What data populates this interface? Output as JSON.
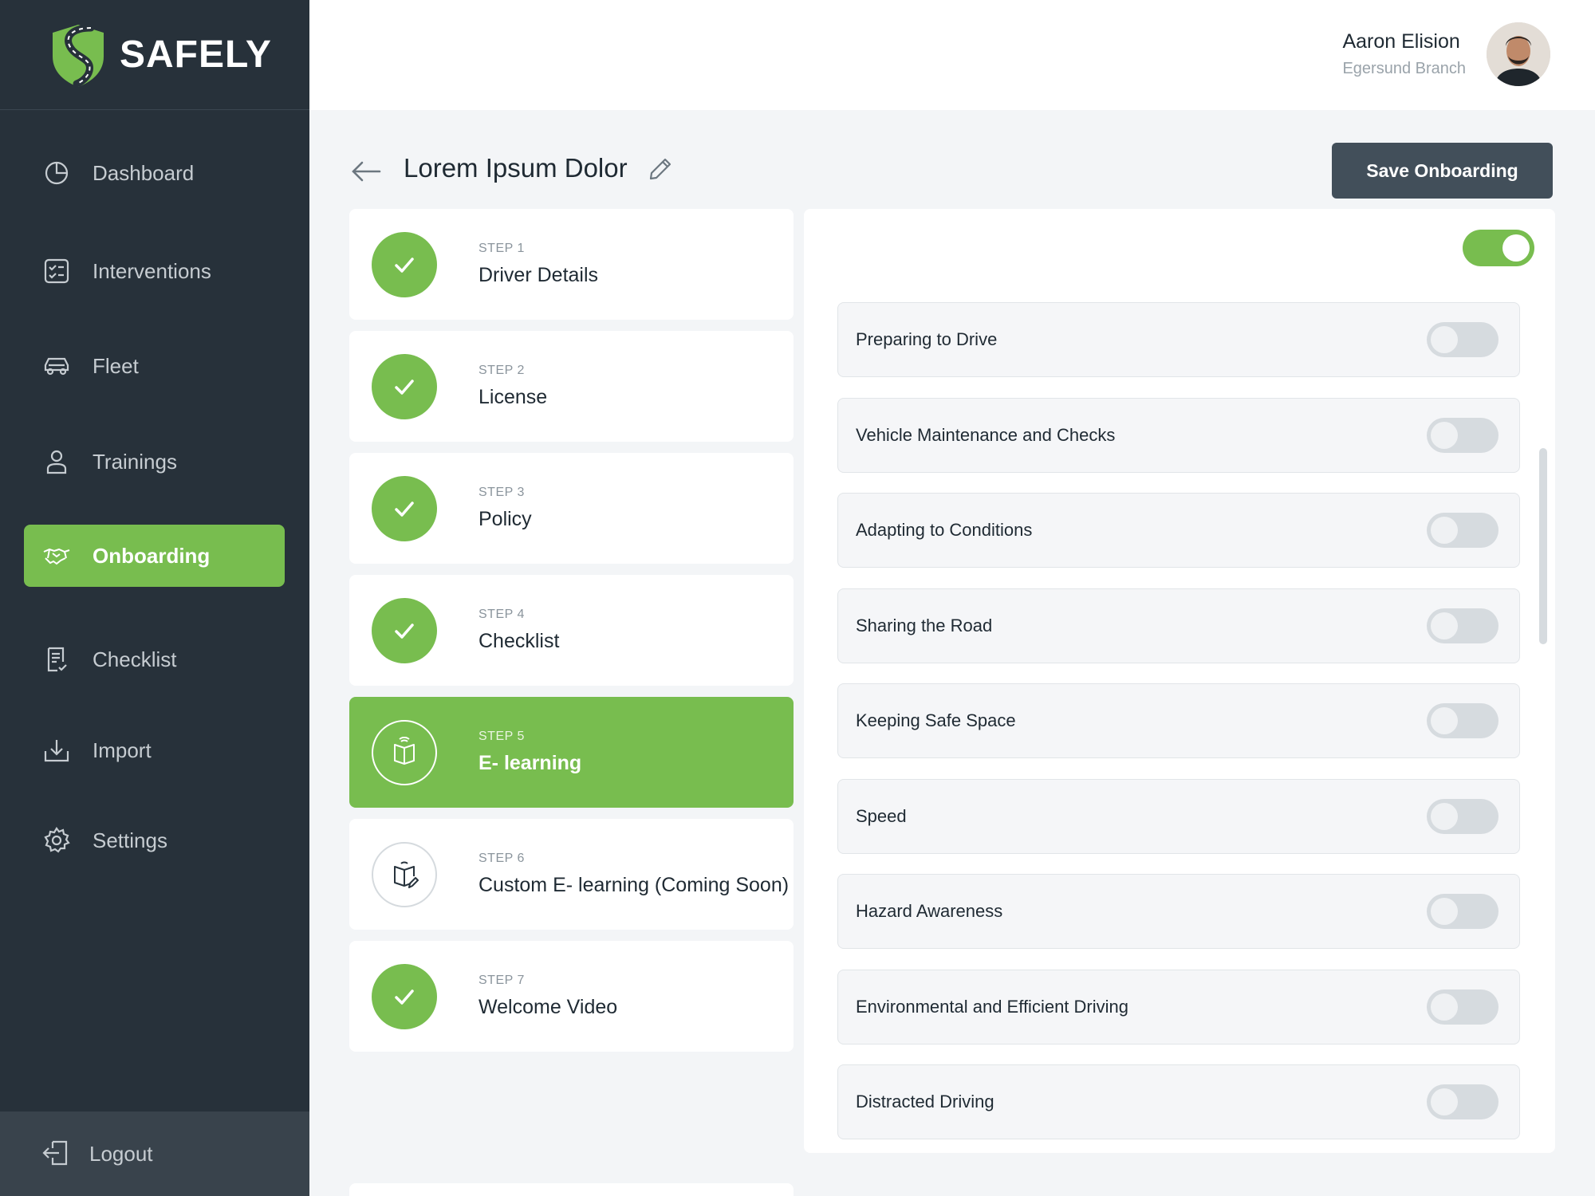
{
  "brand": {
    "name": "SAFELY",
    "icon": "shield-road-logo",
    "accent": "#78bd4f"
  },
  "sidebar": {
    "items": [
      {
        "label": "Dashboard",
        "icon": "pie-chart-icon"
      },
      {
        "label": "Interventions",
        "icon": "checklist-board-icon"
      },
      {
        "label": "Fleet",
        "icon": "car-icon"
      },
      {
        "label": "Trainings",
        "icon": "person-icon"
      },
      {
        "label": "Onboarding",
        "icon": "handshake-icon",
        "active": true
      },
      {
        "label": "Checklist",
        "icon": "document-check-icon"
      },
      {
        "label": "Import",
        "icon": "download-icon"
      },
      {
        "label": "Settings",
        "icon": "gear-icon"
      }
    ],
    "logout": {
      "label": "Logout",
      "icon": "logout-icon"
    }
  },
  "user": {
    "name": "Aaron Elision",
    "branch": "Egersund Branch"
  },
  "page": {
    "title": "Lorem Ipsum Dolor",
    "save_label": "Save Onboarding"
  },
  "steps": [
    {
      "number": "STEP 1",
      "name": "Driver Details",
      "status": "done"
    },
    {
      "number": "STEP 2",
      "name": "License",
      "status": "done"
    },
    {
      "number": "STEP 3",
      "name": "Policy",
      "status": "done"
    },
    {
      "number": "STEP 4",
      "name": "Checklist",
      "status": "done"
    },
    {
      "number": "STEP 5",
      "name": "E- learning",
      "status": "current"
    },
    {
      "number": "STEP 6",
      "name": "Custom E- learning (Coming Soon)",
      "status": "upcoming"
    },
    {
      "number": "STEP 7",
      "name": "Welcome Video",
      "status": "done"
    }
  ],
  "panel": {
    "master_toggle": true,
    "modules": [
      {
        "label": "Preparing to Drive",
        "enabled": false
      },
      {
        "label": "Vehicle Maintenance and Checks",
        "enabled": false
      },
      {
        "label": "Adapting to Conditions",
        "enabled": false
      },
      {
        "label": "Sharing the Road",
        "enabled": false
      },
      {
        "label": "Keeping Safe Space",
        "enabled": false
      },
      {
        "label": "Speed",
        "enabled": false
      },
      {
        "label": "Hazard Awareness",
        "enabled": false
      },
      {
        "label": "Environmental and Efficient Driving",
        "enabled": false
      },
      {
        "label": "Distracted Driving",
        "enabled": false
      }
    ]
  }
}
